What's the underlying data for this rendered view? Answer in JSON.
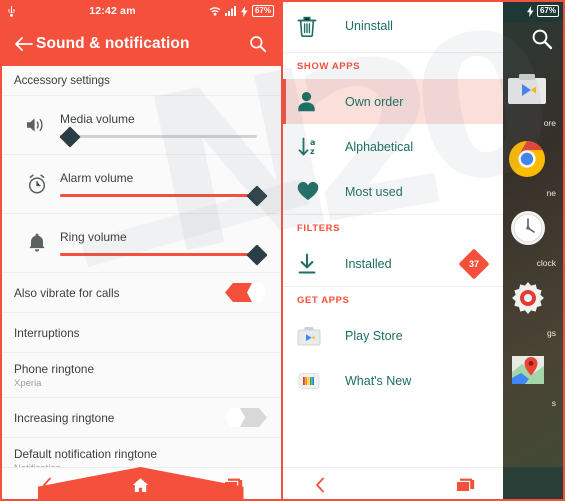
{
  "left_screen": {
    "status_bar": {
      "usb_icon": "usb-icon",
      "time": "12:42 am",
      "wifi_icon": "wifi-icon",
      "signal_icon": "signal-icon",
      "charging_icon": "charging-bolt-icon",
      "battery": "67%"
    },
    "app_bar": {
      "back_icon": "arrow-back-icon",
      "title": "Sound & notification",
      "search_icon": "search-icon"
    },
    "section_header": "Accessory settings",
    "sliders": [
      {
        "icon": "speaker-volume-icon",
        "label": "Media volume",
        "value": 5
      },
      {
        "icon": "alarm-clock-icon",
        "label": "Alarm volume",
        "value": 100
      },
      {
        "icon": "bell-ring-icon",
        "label": "Ring volume",
        "value": 100
      }
    ],
    "rows": [
      {
        "title": "Also vibrate for calls",
        "subtitle": "",
        "toggle": "on"
      },
      {
        "title": "Interruptions",
        "subtitle": "",
        "toggle": "none"
      },
      {
        "title": "Phone ringtone",
        "subtitle": "Xperia",
        "toggle": "none"
      },
      {
        "title": "Increasing ringtone",
        "subtitle": "",
        "toggle": "off"
      },
      {
        "title": "Default notification ringtone",
        "subtitle": "Notification",
        "toggle": "none"
      }
    ],
    "nav_bar": {
      "back_icon": "nav-back-icon",
      "home_icon": "nav-home-icon",
      "recents_icon": "nav-recents-icon"
    }
  },
  "right_screen": {
    "status_bar": {
      "charging_icon": "charging-bolt-icon",
      "battery": "67%"
    },
    "drawer": {
      "search_icon": "search-icon",
      "apps": [
        {
          "name": "ore",
          "icon": "play-store-icon"
        },
        {
          "name": "ne",
          "icon": "chrome-icon"
        },
        {
          "name": "clock",
          "icon": "clock-icon"
        },
        {
          "name": "gs",
          "icon": "settings-gear-icon"
        },
        {
          "name": "s",
          "icon": "maps-pin-icon"
        }
      ]
    },
    "menu": {
      "items": [
        {
          "type": "item",
          "icon": "trash-icon",
          "label": "Uninstall",
          "selected": false,
          "badge": ""
        },
        {
          "type": "header",
          "label": "SHOW APPS"
        },
        {
          "type": "item",
          "icon": "person-icon",
          "label": "Own order",
          "selected": true,
          "badge": ""
        },
        {
          "type": "item",
          "icon": "sort-alphabetical-icon",
          "label": "Alphabetical",
          "selected": false,
          "badge": ""
        },
        {
          "type": "item",
          "icon": "heart-icon",
          "label": "Most used",
          "selected": false,
          "badge": ""
        },
        {
          "type": "header",
          "label": "FILTERS"
        },
        {
          "type": "item",
          "icon": "download-icon",
          "label": "Installed",
          "selected": false,
          "badge": "37"
        },
        {
          "type": "header",
          "label": "GET APPS"
        },
        {
          "type": "item",
          "icon": "play-store-icon",
          "label": "Play Store",
          "selected": false,
          "badge": ""
        },
        {
          "type": "item",
          "icon": "whats-new-icon",
          "label": "What's New",
          "selected": false,
          "badge": ""
        }
      ]
    },
    "nav_bar": {
      "back_icon": "nav-back-icon",
      "recents_icon": "nav-recents-icon"
    }
  },
  "watermark": {
    "characters": [
      "N",
      "2",
      "0"
    ]
  },
  "colors": {
    "accent_red": "#f4503c",
    "teal_text": "#1d6f63",
    "selected_row_bg": "#fbdfdb",
    "thumb_dark": "#2b3d45",
    "track_grey": "#cfd2d3"
  }
}
